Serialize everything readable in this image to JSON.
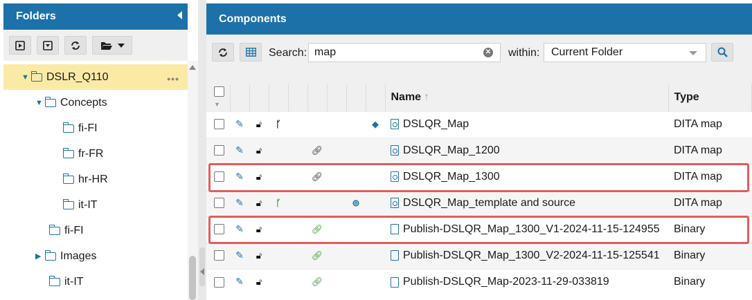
{
  "left": {
    "title": "Folders",
    "tree": [
      {
        "label": "DSLR_Q110",
        "level": 0,
        "expanded": true,
        "selected": true
      },
      {
        "label": "Concepts",
        "level": 1,
        "expanded": true
      },
      {
        "label": "fi-FI",
        "level": 2
      },
      {
        "label": "fr-FR",
        "level": 2
      },
      {
        "label": "hr-HR",
        "level": 2
      },
      {
        "label": "it-IT",
        "level": 2
      },
      {
        "label": "fi-FI",
        "level": 1
      },
      {
        "label": "Images",
        "level": 1,
        "expanded": false
      },
      {
        "label": "it-IT",
        "level": 1
      }
    ],
    "more_label": "•••"
  },
  "right": {
    "title": "Components",
    "search_label": "Search:",
    "search_value": "map",
    "within_label": "within:",
    "within_value": "Current Folder",
    "columns": {
      "name": "Name",
      "type": "Type"
    },
    "rows": [
      {
        "name": "DSLQR_Map",
        "type": "DITA map",
        "icon": "map",
        "branch": "black",
        "attach": "",
        "tag": true,
        "bino": false
      },
      {
        "name": "DSLQR_Map_1200",
        "type": "DITA map",
        "icon": "map",
        "branch": "",
        "attach": "black",
        "tag": false,
        "bino": false
      },
      {
        "name": "DSLQR_Map_1300",
        "type": "DITA map",
        "icon": "map",
        "branch": "",
        "attach": "black",
        "tag": false,
        "bino": false
      },
      {
        "name": "DSLQR_Map_template and source",
        "type": "DITA map",
        "icon": "map",
        "branch": "green",
        "attach": "",
        "tag": false,
        "bino": true
      },
      {
        "name": "Publish-DSLQR_Map_1300_V1-2024-11-15-124955",
        "type": "Binary",
        "icon": "doc",
        "branch": "",
        "attach": "green",
        "tag": false,
        "bino": false
      },
      {
        "name": "Publish-DSLQR_Map_1300_V2-2024-11-15-125541",
        "type": "Binary",
        "icon": "doc",
        "branch": "",
        "attach": "green",
        "tag": false,
        "bino": false
      },
      {
        "name": "Publish-DSLQR_Map-2023-11-29-033819",
        "type": "Binary",
        "icon": "doc",
        "branch": "",
        "attach": "green",
        "tag": false,
        "bino": false
      }
    ]
  },
  "colors": {
    "header": "#1c71a8",
    "highlight": "#e35c5c",
    "selected_row": "#fbeaa6"
  }
}
